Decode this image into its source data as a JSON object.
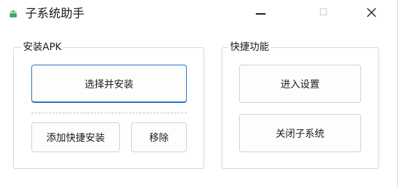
{
  "window": {
    "title": "子系统助手",
    "app_icon": "android-icon",
    "controls": {
      "minimize": "minimize-icon",
      "maximize": "maximize-icon",
      "close": "close-icon"
    }
  },
  "install_group": {
    "title": "安装APK",
    "select_install_label": "选择并安装",
    "add_shortcut_install_label": "添加快捷安装",
    "remove_label": "移除"
  },
  "quick_group": {
    "title": "快捷功能",
    "enter_settings_label": "进入设置",
    "close_subsystem_label": "关闭子系统"
  },
  "colors": {
    "accent": "#1f6fbf",
    "icon": "#3aa86b"
  }
}
